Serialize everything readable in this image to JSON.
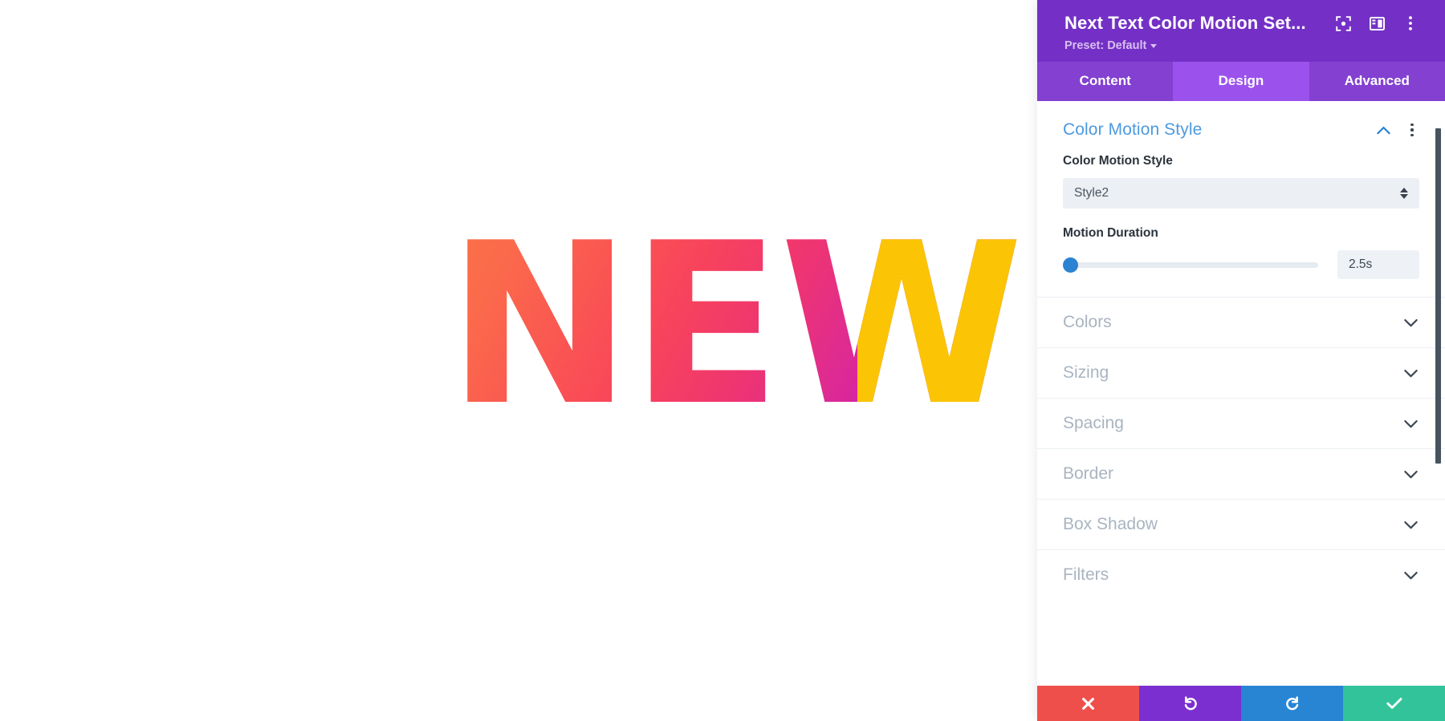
{
  "canvas": {
    "hero_text": "NEW",
    "gradient_from": "#fb7149",
    "gradient_mid": "#f8435c",
    "gradient_to": "#bf16c6",
    "overlay_color": "#fbc404"
  },
  "panel": {
    "header": {
      "title": "Next Text Color Motion Set...",
      "preset_label": "Preset: Default",
      "background": "#7430c6",
      "icons": [
        "focus-icon",
        "layout-panel-icon",
        "more-options-icon"
      ]
    },
    "tabs": [
      {
        "label": "Content",
        "active": false
      },
      {
        "label": "Design",
        "active": true
      },
      {
        "label": "Advanced",
        "active": false
      }
    ],
    "open_group": {
      "title": "Color Motion Style",
      "title_color": "#4c9ae0",
      "fields": [
        {
          "label": "Color Motion Style",
          "type": "select",
          "value": "Style2"
        },
        {
          "label": "Motion Duration",
          "type": "slider",
          "value": "2.5s",
          "thumb_position_percent": 0,
          "thumb_color": "#2b82d2"
        }
      ]
    },
    "accordions": [
      {
        "label": "Colors"
      },
      {
        "label": "Sizing"
      },
      {
        "label": "Spacing"
      },
      {
        "label": "Border"
      },
      {
        "label": "Box Shadow"
      },
      {
        "label": "Filters"
      }
    ],
    "actions": [
      {
        "name": "cancel",
        "icon": "close-icon",
        "color": "#ef4f4b"
      },
      {
        "name": "undo",
        "icon": "undo-icon",
        "color": "#7b2fd0"
      },
      {
        "name": "redo",
        "icon": "redo-icon",
        "color": "#2785d3"
      },
      {
        "name": "save",
        "icon": "check-icon",
        "color": "#33c39a"
      }
    ]
  }
}
